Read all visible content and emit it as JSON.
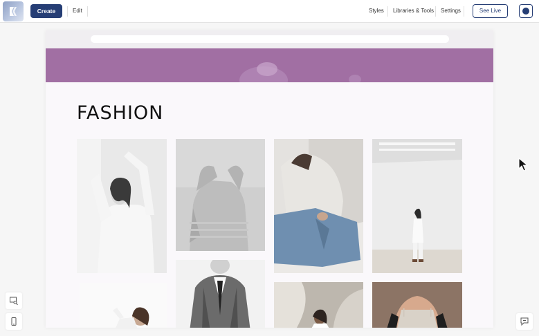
{
  "toolbar": {
    "create_label": "Create",
    "edit_label": "Edit",
    "styles_label": "Styles",
    "libraries_label": "Libraries & Tools",
    "settings_label": "Settings",
    "see_live_label": "See Live"
  },
  "page": {
    "heading": "FASHION"
  },
  "colors": {
    "brand": "#263e75",
    "banner": "#a16fa3"
  },
  "icons": {
    "logo": "app-logo-icon",
    "avatar": "avatar-icon",
    "preview": "preview-search-icon",
    "mobile": "mobile-device-icon",
    "feedback": "feedback-chat-icon",
    "cursor": "mouse-cursor-icon"
  },
  "gallery": {
    "images": [
      "photo-1",
      "photo-2",
      "photo-3",
      "photo-4",
      "photo-5",
      "photo-6",
      "photo-7",
      "photo-8",
      "photo-9"
    ]
  }
}
